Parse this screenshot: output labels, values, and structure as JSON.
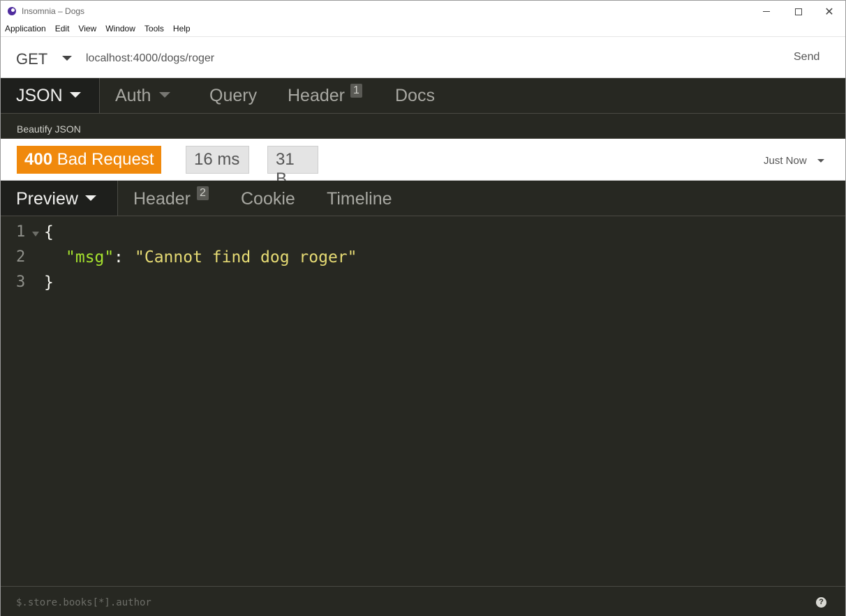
{
  "window": {
    "title": "Insomnia – Dogs",
    "controls": {
      "minimize": "minimize",
      "maximize": "maximize",
      "close": "✕"
    }
  },
  "menu": [
    "Application",
    "Edit",
    "View",
    "Window",
    "Tools",
    "Help"
  ],
  "request": {
    "method": "GET",
    "url": "localhost:4000/dogs/roger",
    "send_label": "Send"
  },
  "request_tabs": {
    "body": "JSON",
    "auth": "Auth",
    "query": "Query",
    "header": "Header",
    "header_count": "1",
    "docs": "Docs"
  },
  "body_toolbar": {
    "beautify": "Beautify JSON"
  },
  "response": {
    "status_code": "400",
    "status_text": "Bad Request",
    "status_color": "#f0890c",
    "time": "16 ms",
    "size": "31 B",
    "history": "Just Now"
  },
  "response_tabs": {
    "preview": "Preview",
    "header": "Header",
    "header_count": "2",
    "cookie": "Cookie",
    "timeline": "Timeline"
  },
  "code": {
    "line_numbers": [
      "1",
      "2",
      "3"
    ],
    "open_brace": "{",
    "key": "\"msg\"",
    "colon": ":",
    "value": "\"Cannot find dog roger\"",
    "close_brace": "}"
  },
  "footer": {
    "filter_placeholder": "$.store.books[*].author",
    "help": "?"
  }
}
